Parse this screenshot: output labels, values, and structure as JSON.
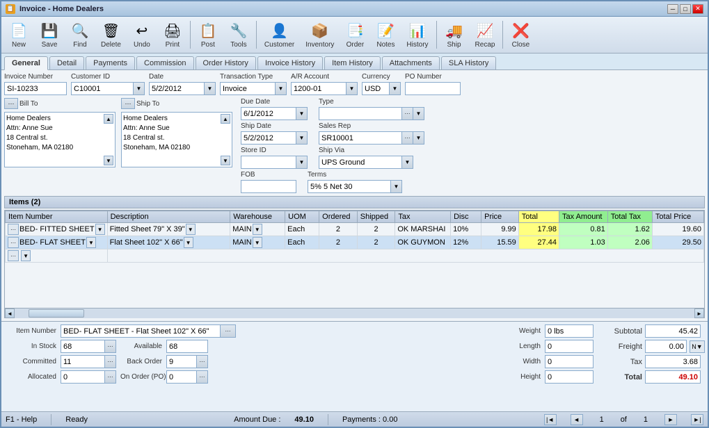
{
  "window": {
    "title": "Invoice - Home Dealers"
  },
  "toolbar": {
    "buttons": [
      {
        "id": "new",
        "label": "New",
        "icon": "📄"
      },
      {
        "id": "save",
        "label": "Save",
        "icon": "💾"
      },
      {
        "id": "find",
        "label": "Find",
        "icon": "🔍"
      },
      {
        "id": "delete",
        "label": "Delete",
        "icon": "🗑"
      },
      {
        "id": "undo",
        "label": "Undo",
        "icon": "↩"
      },
      {
        "id": "print",
        "label": "Print",
        "icon": "🖨"
      },
      {
        "id": "post",
        "label": "Post",
        "icon": "📋"
      },
      {
        "id": "tools",
        "label": "Tools",
        "icon": "🔧"
      },
      {
        "id": "customer",
        "label": "Customer",
        "icon": "👤"
      },
      {
        "id": "inventory",
        "label": "Inventory",
        "icon": "📦"
      },
      {
        "id": "order",
        "label": "Order",
        "icon": "📑"
      },
      {
        "id": "notes",
        "label": "Notes",
        "icon": "📝"
      },
      {
        "id": "history",
        "label": "History",
        "icon": "📊"
      },
      {
        "id": "ship",
        "label": "Ship",
        "icon": "🚚"
      },
      {
        "id": "recap",
        "label": "Recap",
        "icon": "📈"
      },
      {
        "id": "close",
        "label": "Close",
        "icon": "❌"
      }
    ]
  },
  "tabs": [
    {
      "id": "general",
      "label": "General",
      "active": true
    },
    {
      "id": "detail",
      "label": "Detail"
    },
    {
      "id": "payments",
      "label": "Payments"
    },
    {
      "id": "commission",
      "label": "Commission"
    },
    {
      "id": "order_history",
      "label": "Order History"
    },
    {
      "id": "invoice_history",
      "label": "Invoice History"
    },
    {
      "id": "item_history",
      "label": "Item History"
    },
    {
      "id": "attachments",
      "label": "Attachments"
    },
    {
      "id": "sla_history",
      "label": "SLA History"
    }
  ],
  "form": {
    "invoice_number_label": "Invoice Number",
    "invoice_number": "SI-10233",
    "customer_id_label": "Customer ID",
    "customer_id": "C10001",
    "date_label": "Date",
    "date": "5/2/2012",
    "transaction_type_label": "Transaction Type",
    "transaction_type": "Invoice",
    "ar_account_label": "A/R Account",
    "ar_account": "1200-01",
    "currency_label": "Currency",
    "currency": "USD",
    "po_number_label": "PO Number",
    "po_number": "",
    "bill_to_label": "Bill To",
    "ship_to_label": "Ship To",
    "bill_to_address": "Home Dealers\nAttn: Anne Sue\n18 Central st.\nStoneham, MA 02180",
    "ship_to_address": "Home Dealers\nAttn: Anne Sue\n18 Central st.\nStoneham, MA 02180",
    "due_date_label": "Due Date",
    "due_date": "6/1/2012",
    "type_label": "Type",
    "type": "",
    "ship_date_label": "Ship Date",
    "ship_date": "5/2/2012",
    "sales_rep_label": "Sales Rep",
    "sales_rep": "SR10001",
    "store_id_label": "Store ID",
    "store_id": "",
    "ship_via_label": "Ship Via",
    "ship_via": "UPS Ground",
    "fob_label": "FOB",
    "fob": "",
    "terms_label": "Terms",
    "terms": "5% 5 Net 30"
  },
  "items_section": {
    "header": "Items (2)",
    "columns": [
      "Item Number",
      "Description",
      "Warehouse",
      "UOM",
      "Ordered",
      "Shipped",
      "Tax",
      "Disc",
      "Price",
      "Total",
      "Tax Amount",
      "Total Tax",
      "Total Price"
    ],
    "rows": [
      {
        "item_number": "BED- FITTED SHEET",
        "description": "Fitted Sheet 79\" X 39\"",
        "warehouse": "MAIN",
        "uom": "Each",
        "ordered": "2",
        "shipped": "2",
        "tax": "OK MARSHAI",
        "disc": "10%",
        "price": "9.99",
        "total": "17.98",
        "tax_amount": "0.81",
        "total_tax": "1.62",
        "total_price": "19.60"
      },
      {
        "item_number": "BED- FLAT SHEET",
        "description": "Flat Sheet 102\" X 66\"",
        "warehouse": "MAIN",
        "uom": "Each",
        "ordered": "2",
        "shipped": "2",
        "tax": "OK GUYMON",
        "disc": "12%",
        "price": "15.59",
        "total": "27.44",
        "tax_amount": "1.03",
        "total_tax": "2.06",
        "total_price": "29.50"
      }
    ]
  },
  "bottom_panel": {
    "item_number_label": "Item Number",
    "item_number_value": "BED- FLAT SHEET - Flat Sheet 102\" X 66\"",
    "in_stock_label": "In Stock",
    "in_stock_value": "68",
    "available_label": "Available",
    "available_value": "68",
    "committed_label": "Committed",
    "committed_value": "11",
    "back_order_label": "Back Order",
    "back_order_value": "9",
    "allocated_label": "Allocated",
    "allocated_value": "0",
    "on_order_label": "On Order (PO)",
    "on_order_value": "0",
    "weight_label": "Weight",
    "weight_value": "0 lbs",
    "length_label": "Length",
    "length_value": "0",
    "width_label": "Width",
    "width_value": "0",
    "height_label": "Height",
    "height_value": "0",
    "subtotal_label": "Subtotal",
    "subtotal_value": "45.42",
    "freight_label": "Freight",
    "freight_value": "0.00",
    "tax_label": "Tax",
    "tax_value": "3.68",
    "total_label": "Total",
    "total_value": "49.10"
  },
  "status_bar": {
    "help": "F1 - Help",
    "status": "Ready",
    "amount_due_label": "Amount Due :",
    "amount_due": "49.10",
    "payments_label": "Payments : 0.00",
    "page_label": "1",
    "page_of": "of",
    "page_total": "1"
  }
}
